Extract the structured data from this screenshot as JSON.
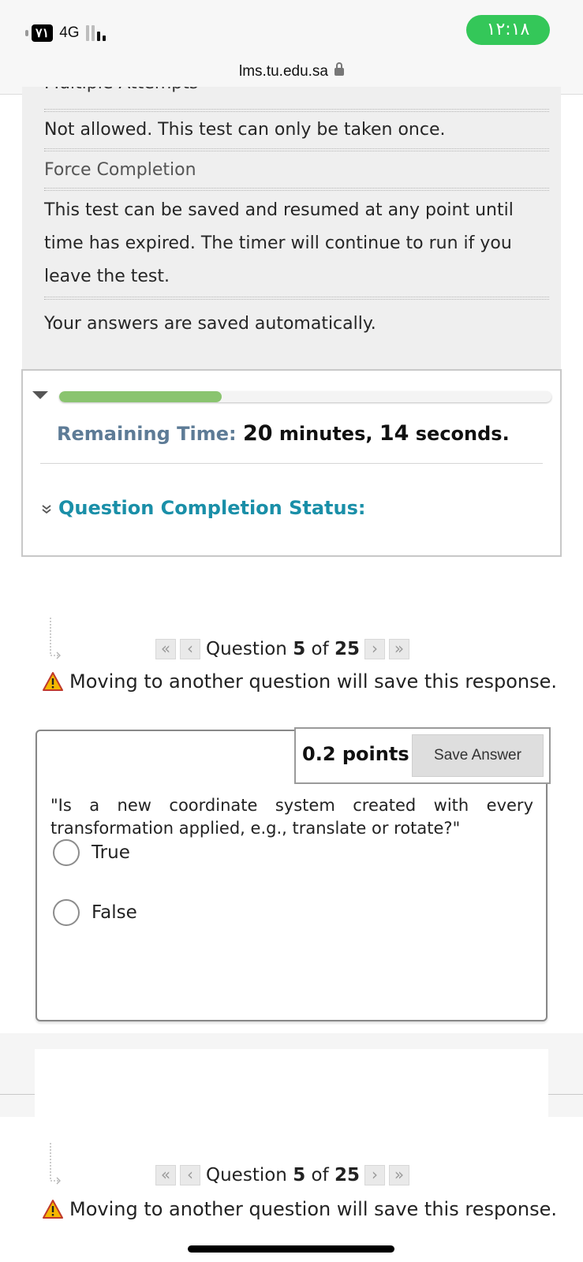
{
  "status_bar": {
    "sim_label": "٧١",
    "network": "4G",
    "signal_bars": 2,
    "time": "١٢:١٨",
    "time_pill_color": "#34c759"
  },
  "browser": {
    "url": "lms.tu.edu.sa",
    "lock_icon": "lock-icon"
  },
  "instructions": {
    "clipped_heading": "Multiple Attempts",
    "attempts_value": "Not allowed. This test can only be taken once.",
    "force_completion_label": "Force Completion",
    "force_completion_lines": [
      "This test can be saved and resumed at any point until",
      "time has expired. The timer will continue to run if you",
      "leave the test."
    ],
    "autosave_note": "Your answers are saved automatically."
  },
  "timer": {
    "progress_fraction": 0.33,
    "progress_color": "#8ac46f",
    "label": "Remaining Time:",
    "minutes": "20",
    "minutes_unit": "minutes,",
    "seconds": "14",
    "seconds_unit": "seconds.",
    "completion_status_label": "Question Completion Status:"
  },
  "navigation": {
    "question_word": "Question",
    "current": "5",
    "of_word": "of",
    "total": "25",
    "warning": "Moving to another question will save this response."
  },
  "question": {
    "points": "0.2 points",
    "save_label": "Save Answer",
    "text": "\"Is a new coordinate system created with every transformation applied, e.g., translate or rotate?\"",
    "options": [
      "True",
      "False"
    ]
  }
}
